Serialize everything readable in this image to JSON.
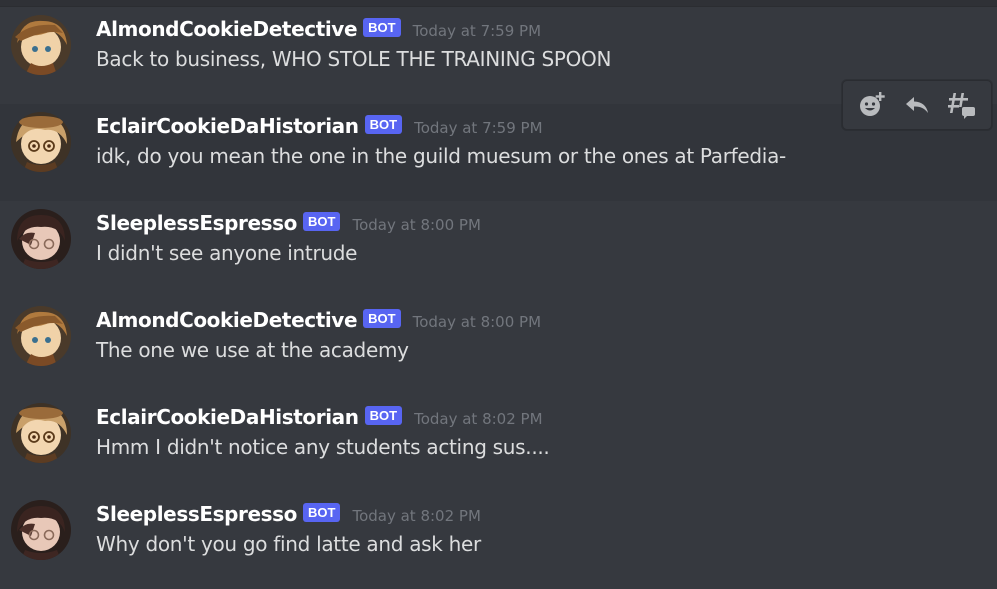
{
  "messages": [
    {
      "username": "AlmondCookieDetective",
      "bot_tag": "BOT",
      "timestamp": "Today at 7:59 PM",
      "content": "Back to business, WHO STOLE THE TRAINING SPOON",
      "avatar": "almond-cookie-avatar"
    },
    {
      "username": "EclairCookieDaHistorian",
      "bot_tag": "BOT",
      "timestamp": "Today at 7:59 PM",
      "content": "idk, do you mean the one in the guild muesum or the ones at Parfedia-",
      "avatar": "eclair-cookie-avatar"
    },
    {
      "username": "SleeplessEspresso",
      "bot_tag": "BOT",
      "timestamp": "Today at 8:00 PM",
      "content": "I didn't see anyone intrude",
      "avatar": "espresso-cookie-avatar"
    },
    {
      "username": "AlmondCookieDetective",
      "bot_tag": "BOT",
      "timestamp": "Today at 8:00 PM",
      "content": "The one we use at the academy",
      "avatar": "almond-cookie-avatar"
    },
    {
      "username": "EclairCookieDaHistorian",
      "bot_tag": "BOT",
      "timestamp": "Today at 8:02 PM",
      "content": "Hmm I didn't notice any students acting sus....",
      "avatar": "eclair-cookie-avatar"
    },
    {
      "username": "SleeplessEspresso",
      "bot_tag": "BOT",
      "timestamp": "Today at 8:02 PM",
      "content": "Why don't you go find latte and ask her",
      "avatar": "espresso-cookie-avatar"
    }
  ],
  "hover_toolbar": {
    "buttons": [
      {
        "icon": "add-reaction-icon"
      },
      {
        "icon": "reply-icon"
      },
      {
        "icon": "create-thread-icon"
      }
    ]
  },
  "colors": {
    "background": "#36393f",
    "hover_background": "#32353b",
    "username": "#ffffff",
    "bot_tag": "#5865f2",
    "timestamp": "#72767d",
    "text": "#dcddde",
    "icon": "#b9bbbe"
  }
}
